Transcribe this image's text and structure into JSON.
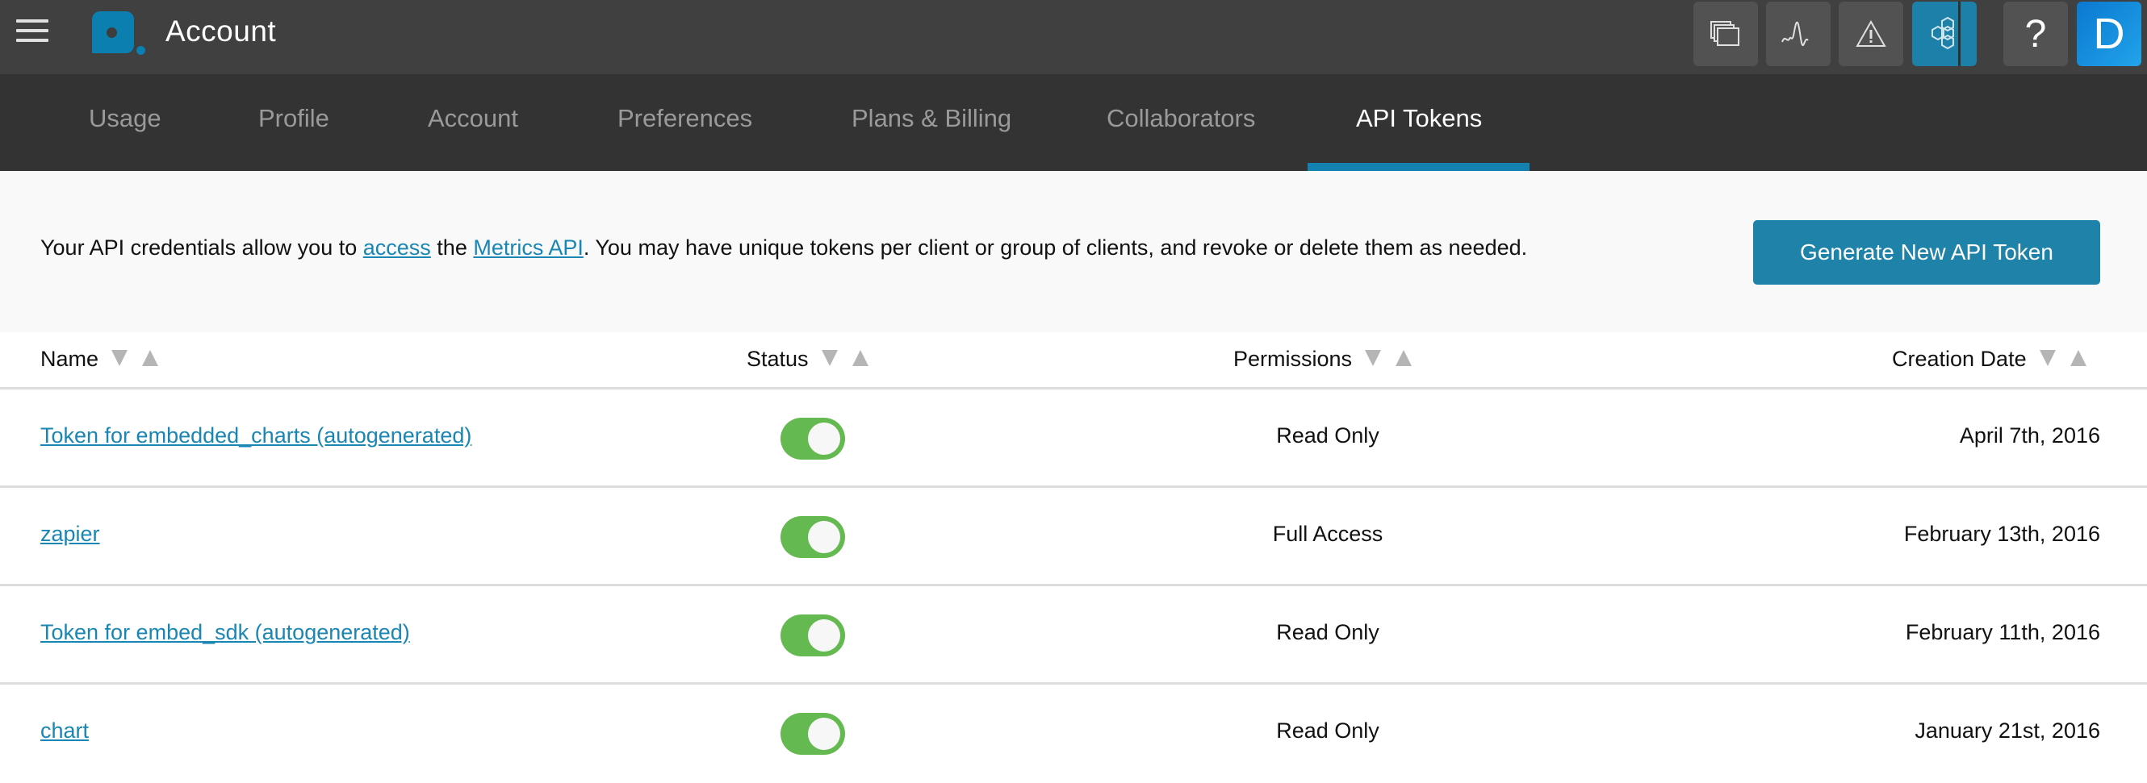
{
  "topbar": {
    "title": "Account",
    "icons": [
      {
        "name": "windows-icon"
      },
      {
        "name": "metrics-icon"
      },
      {
        "name": "alert-icon"
      },
      {
        "name": "integrations-icon",
        "active": true
      },
      {
        "name": "help-icon",
        "label": "?"
      },
      {
        "name": "user-avatar",
        "label": "D"
      }
    ]
  },
  "tabs": [
    {
      "label": "Usage"
    },
    {
      "label": "Profile"
    },
    {
      "label": "Account"
    },
    {
      "label": "Preferences"
    },
    {
      "label": "Plans & Billing"
    },
    {
      "label": "Collaborators"
    },
    {
      "label": "API Tokens",
      "active": true
    }
  ],
  "info": {
    "text_before": "Your API credentials allow you to ",
    "link1": "access",
    "text_middle": " the ",
    "link2": "Metrics API",
    "text_after": ". You may have unique tokens per client or group of clients, and revoke or delete them as needed.",
    "generate_button": "Generate New API Token"
  },
  "table": {
    "headers": [
      "Name",
      "Status",
      "Permissions",
      "Creation Date"
    ],
    "rows": [
      {
        "name": "Token for embedded_charts (autogenerated)",
        "enabled": true,
        "permissions": "Read Only",
        "created": "April 7th, 2016"
      },
      {
        "name": "zapier",
        "enabled": true,
        "permissions": "Full Access",
        "created": "February 13th, 2016"
      },
      {
        "name": "Token for embed_sdk (autogenerated)",
        "enabled": true,
        "permissions": "Read Only",
        "created": "February 11th, 2016"
      },
      {
        "name": "chart",
        "enabled": true,
        "permissions": "Read Only",
        "created": "January 21st, 2016"
      }
    ]
  },
  "colors": {
    "topbar_bg": "#404040",
    "tabbar_bg": "#333333",
    "accent": "#1e82a9",
    "link": "#1a86b3",
    "toggle_on": "#64b950"
  }
}
